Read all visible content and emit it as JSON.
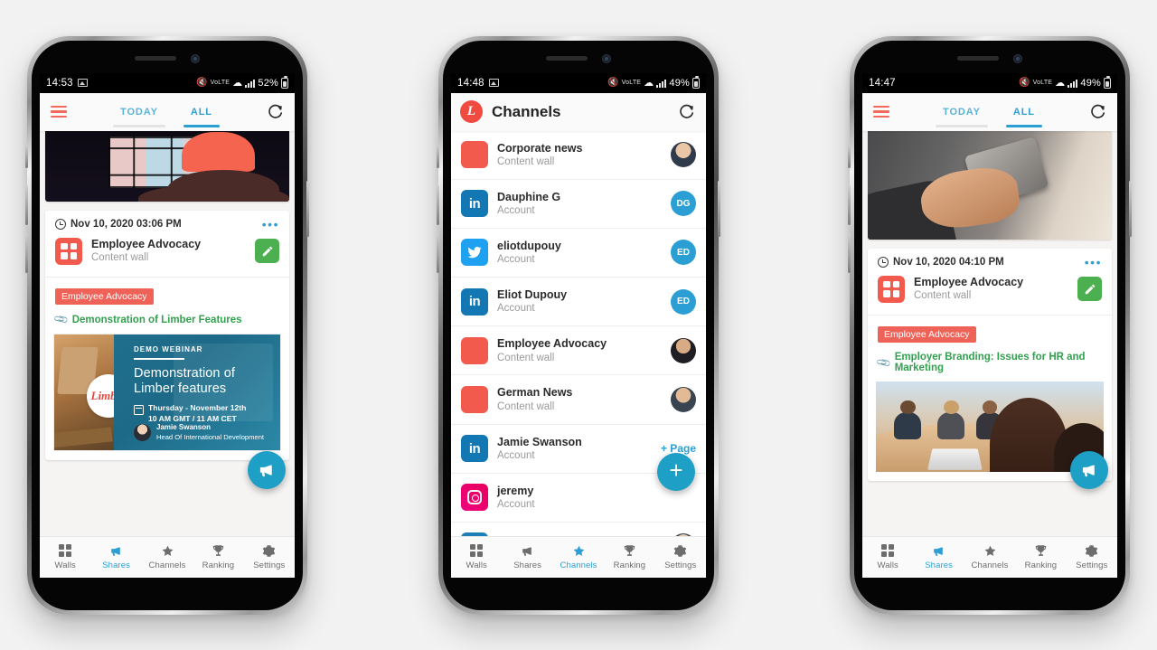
{
  "phones": [
    {
      "id": "phone-feed-1",
      "statusbar": {
        "time": "14:53",
        "battery": "52%",
        "network": "LTE",
        "icons": [
          "image-icon",
          "mute-icon",
          "volte-icon",
          "wifi-icon",
          "signal-icon",
          "battery-icon"
        ]
      },
      "appbar": {
        "menu": "hamburger-menu",
        "tabs": [
          {
            "label": "TODAY",
            "active": false
          },
          {
            "label": "ALL",
            "active": true
          }
        ],
        "refresh": "refresh-icon"
      },
      "feed": {
        "top_card": {
          "image": "office-illustration"
        },
        "post": {
          "date": "Nov 10, 2020 03:06 PM",
          "wall_name": "Employee Advocacy",
          "wall_sub": "Content wall",
          "tag": "Employee Advocacy",
          "link": "Demonstration of Limber Features",
          "banner": {
            "kicker": "DEMO WEBINAR",
            "title_line1": "Demonstration of",
            "title_line2": "Limber features",
            "when_line1": "Thursday - November 12th",
            "when_line2": "10 AM GMT / 11 AM CET",
            "author_name": "Jamie Swanson",
            "author_role": "Head Of International Development",
            "logo": "Limber"
          }
        }
      },
      "fab": "share-megaphone-fab",
      "nav": [
        {
          "label": "Walls",
          "icon": "walls-grid-icon",
          "active": false
        },
        {
          "label": "Shares",
          "icon": "megaphone-icon",
          "active": true
        },
        {
          "label": "Channels",
          "icon": "star-icon",
          "active": false
        },
        {
          "label": "Ranking",
          "icon": "trophy-icon",
          "active": false
        },
        {
          "label": "Settings",
          "icon": "gear-icon",
          "active": false
        }
      ]
    },
    {
      "id": "phone-channels-2",
      "statusbar": {
        "time": "14:48",
        "battery": "49%",
        "network": "LTE"
      },
      "appbar": {
        "logo": "limber-logo",
        "title": "Channels",
        "refresh": "refresh-icon"
      },
      "channels": [
        {
          "name": "Corporate news",
          "sub": "Content wall",
          "icon": "content-wall-icon",
          "right": "avatar",
          "avatar_style": "photo-a",
          "initials": ""
        },
        {
          "name": "Dauphine G",
          "sub": "Account",
          "icon": "linkedin-icon",
          "right": "initials",
          "avatar_style": "initials",
          "initials": "DG"
        },
        {
          "name": "eliotdupouy",
          "sub": "Account",
          "icon": "twitter-icon",
          "right": "initials",
          "avatar_style": "initials",
          "initials": "ED"
        },
        {
          "name": "Eliot Dupouy",
          "sub": "Account",
          "icon": "linkedin-icon",
          "right": "initials",
          "avatar_style": "initials",
          "initials": "ED"
        },
        {
          "name": "Employee Advocacy",
          "sub": "Content wall",
          "icon": "content-wall-icon",
          "right": "avatar",
          "avatar_style": "photo-b",
          "initials": ""
        },
        {
          "name": "German News",
          "sub": "Content wall",
          "icon": "content-wall-icon",
          "right": "avatar",
          "avatar_style": "photo-c",
          "initials": ""
        },
        {
          "name": "Jamie Swanson",
          "sub": "Account",
          "icon": "linkedin-icon",
          "right": "add-page",
          "add_page_label": "+ Page",
          "avatar_style": "",
          "initials": ""
        },
        {
          "name": "jeremy",
          "sub": "Account",
          "icon": "instagram-icon",
          "right": "none",
          "avatar_style": "",
          "initials": ""
        }
      ],
      "fab": "add-plus-fab",
      "fab_label": "+",
      "nav": [
        {
          "label": "Walls",
          "icon": "walls-grid-icon",
          "active": false
        },
        {
          "label": "Shares",
          "icon": "megaphone-icon",
          "active": false
        },
        {
          "label": "Channels",
          "icon": "star-icon",
          "active": true
        },
        {
          "label": "Ranking",
          "icon": "trophy-icon",
          "active": false
        },
        {
          "label": "Settings",
          "icon": "gear-icon",
          "active": false
        }
      ]
    },
    {
      "id": "phone-feed-3",
      "statusbar": {
        "time": "14:47",
        "battery": "49%",
        "network": "LTE"
      },
      "appbar": {
        "menu": "hamburger-menu",
        "tabs": [
          {
            "label": "TODAY",
            "active": false
          },
          {
            "label": "ALL",
            "active": true
          }
        ],
        "refresh": "refresh-icon"
      },
      "feed": {
        "top_card": {
          "image": "hand-holding-phone"
        },
        "post": {
          "date": "Nov 10, 2020 04:10 PM",
          "wall_name": "Employee Advocacy",
          "wall_sub": "Content wall",
          "tag": "Employee Advocacy",
          "link": "Employer Branding: Issues for HR and Marketing",
          "image": "meeting-room-photo"
        }
      },
      "fab": "share-megaphone-fab",
      "nav": [
        {
          "label": "Walls",
          "icon": "walls-grid-icon",
          "active": false
        },
        {
          "label": "Shares",
          "icon": "megaphone-icon",
          "active": true
        },
        {
          "label": "Channels",
          "icon": "star-icon",
          "active": false
        },
        {
          "label": "Ranking",
          "icon": "trophy-icon",
          "active": false
        },
        {
          "label": "Settings",
          "icon": "gear-icon",
          "active": false
        }
      ]
    }
  ],
  "colors": {
    "accent_blue": "#2b9fd4",
    "brand_red": "#ef4b41",
    "tag_red": "#ef6258",
    "edit_green": "#4cb050",
    "link_green": "#31a14e",
    "fab_teal": "#1d9fc6",
    "page_bg": "#f2f2f2"
  }
}
